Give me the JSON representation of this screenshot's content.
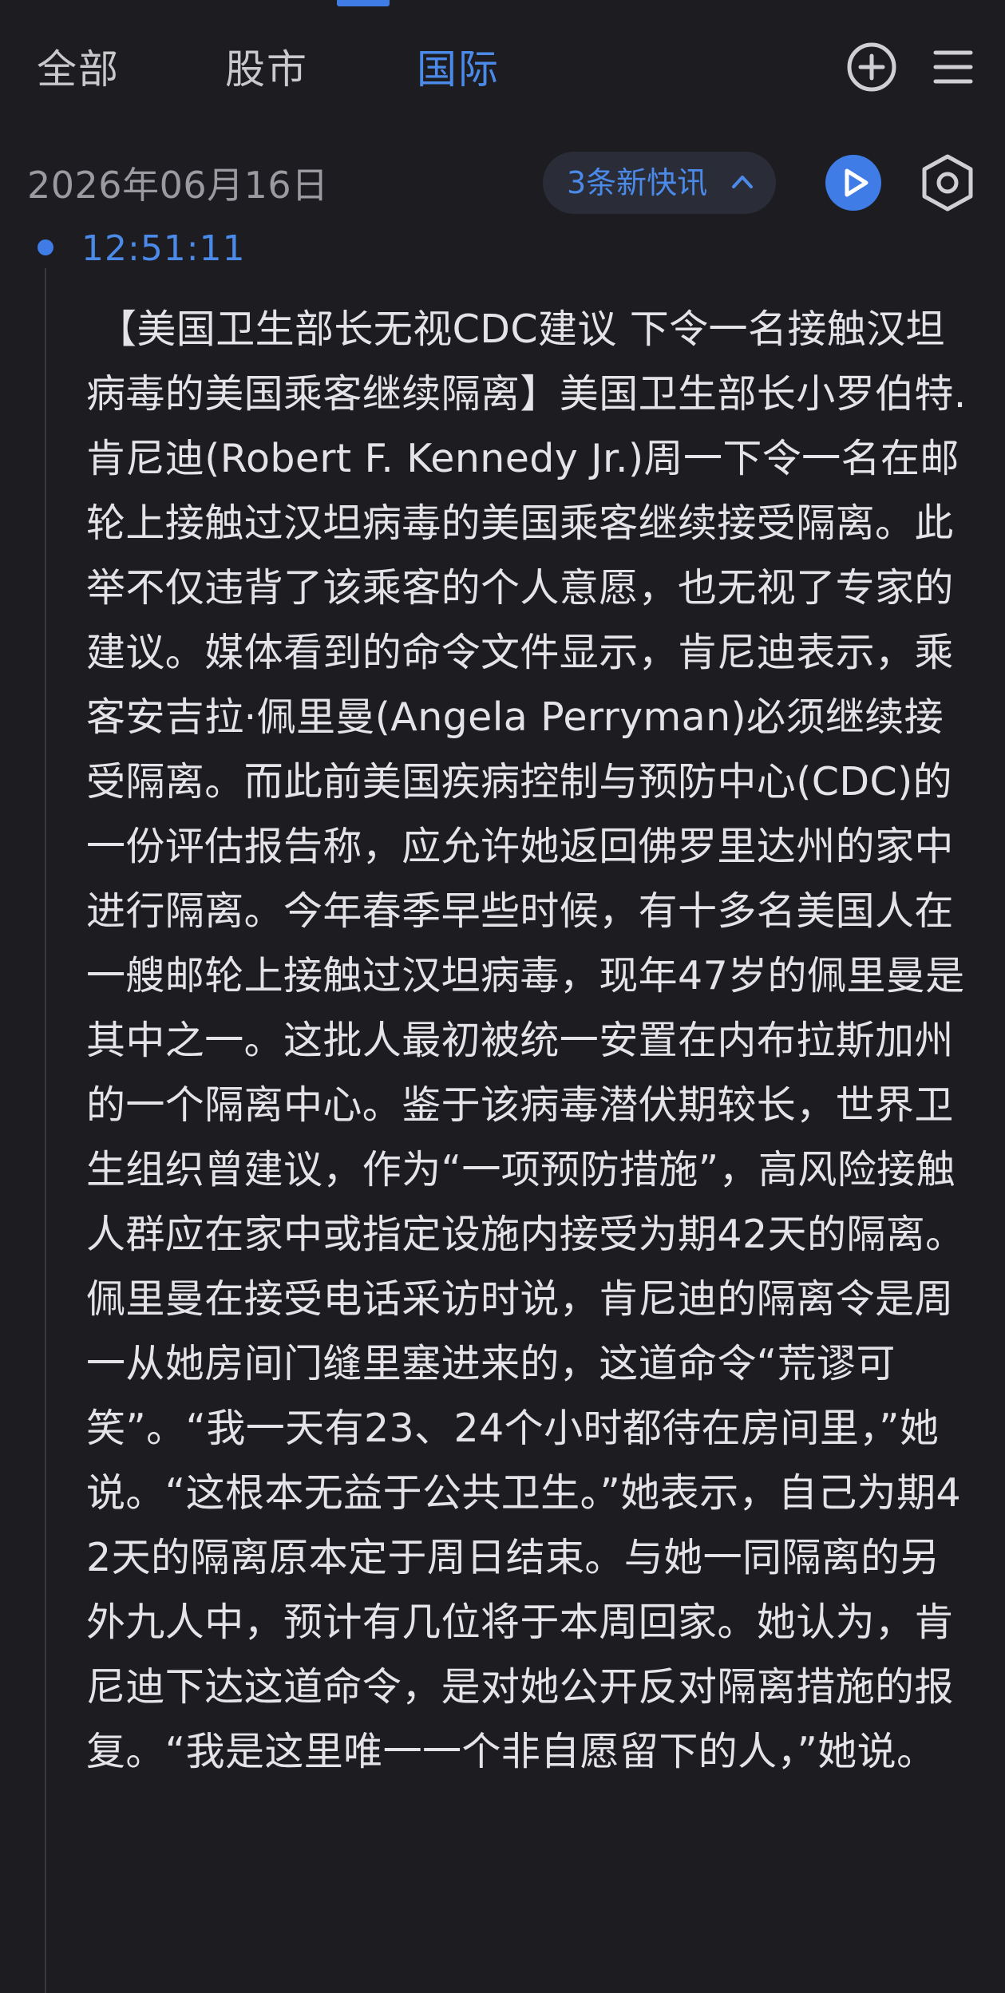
{
  "tabs": [
    {
      "label": "全部",
      "active": false
    },
    {
      "label": "股市",
      "active": false
    },
    {
      "label": "国际",
      "active": true
    }
  ],
  "icons": {
    "add": "plus-circle-icon",
    "menu": "hamburger-menu-icon",
    "play": "play-icon",
    "settings": "hexagon-gear-icon",
    "chevron": "chevron-up-icon"
  },
  "colors": {
    "background": "#1d1d21",
    "accent": "#3f7ce6",
    "accent_text": "#4b8ae8",
    "pill_bg": "#2a2c37",
    "body_text": "#e4e4e8",
    "muted_text": "#9a9aa0"
  },
  "date": "2026年06月16日",
  "news_pill": {
    "label": "3条新快讯"
  },
  "item": {
    "time": "12:51:11",
    "text": "【美国卫生部长无视CDC建议 下令一名接触汉坦病毒的美国乘客继续隔离】美国卫生部长小罗伯特.肯尼迪(Robert F. Kennedy Jr.)周一下令一名在邮轮上接触过汉坦病毒的美国乘客继续接受隔离。此举不仅违背了该乘客的个人意愿，也无视了专家的建议。媒体看到的命令文件显示，肯尼迪表示，乘客安吉拉·佩里曼(Angela Perryman)必须继续接受隔离。而此前美国疾病控制与预防中心(CDC)的一份评估报告称，应允许她返回佛罗里达州的家中进行隔离。今年春季早些时候，有十多名美国人在一艘邮轮上接触过汉坦病毒，现年47岁的佩里曼是其中之一。这批人最初被统一安置在内布拉斯加州的一个隔离中心。鉴于该病毒潜伏期较长，世界卫生组织曾建议，作为“一项预防措施”，高风险接触人群应在家中或指定设施内接受为期42天的隔离。佩里曼在接受电话采访时说，肯尼迪的隔离令是周一从她房间门缝里塞进来的，这道命令“荒谬可笑”。“我一天有23、24个小时都待在房间里，”她说。“这根本无益于公共卫生。”她表示，自己为期42天的隔离原本定于周日结束。与她一同隔离的另外九人中，预计有几位将于本周回家。她认为，肯尼迪下达这道命令，是对她公开反对隔离措施的报复。“我是这里唯一一个非自愿留下的人，”她说。"
  }
}
